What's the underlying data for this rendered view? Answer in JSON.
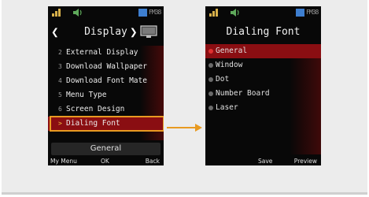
{
  "colors": {
    "panel_bg": "#ececec",
    "highlight_orange": "#e89a21",
    "selection_red": "#8a0e12",
    "screen_bg": "#080808"
  },
  "status_bar": {
    "icons": [
      "signal-icon",
      "speaker-icon",
      "battery-icon"
    ],
    "right_text": "FM38"
  },
  "screen1": {
    "title": "Display",
    "menu": [
      {
        "num": "2",
        "label": "External Display"
      },
      {
        "num": "3",
        "label": "Download Wallpaper"
      },
      {
        "num": "4",
        "label": "Download Font Mate"
      },
      {
        "num": "5",
        "label": "Menu Type"
      },
      {
        "num": "6",
        "label": "Screen Design"
      },
      {
        "num": ">",
        "label": "Dialing Font"
      }
    ],
    "selected_index": 5,
    "preview": "General",
    "softkeys": {
      "left": "My Menu",
      "center": "OK",
      "right": "Back"
    }
  },
  "screen2": {
    "title": "Dialing Font",
    "items": [
      "General",
      "Window",
      "Dot",
      "Number Board",
      "Laser"
    ],
    "selected_index": 0,
    "softkeys": {
      "center": "Save",
      "right": "Preview"
    }
  }
}
